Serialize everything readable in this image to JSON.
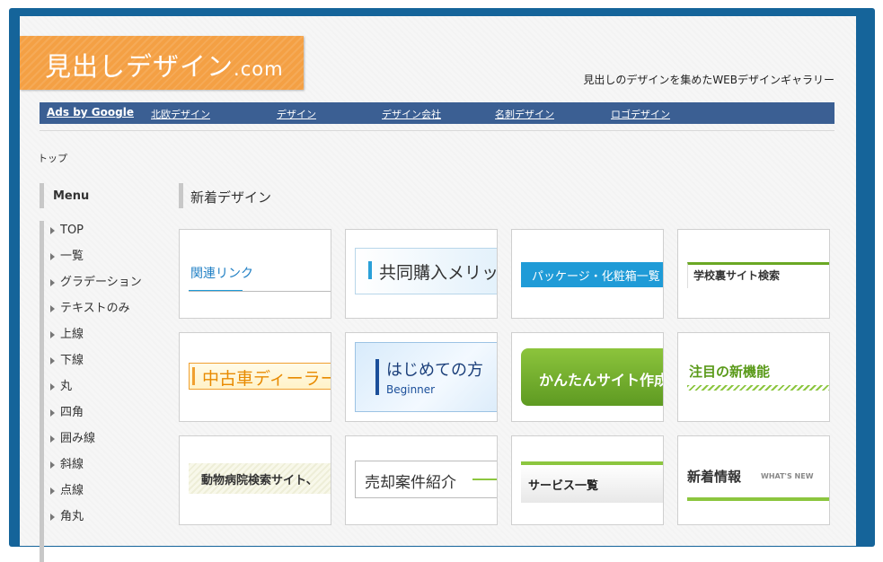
{
  "header": {
    "logo_main": "見出しデザイン",
    "logo_suffix": ".com",
    "tagline": "見出しのデザインを集めたWEBデザインギャラリー"
  },
  "nav": {
    "ads_label": "Ads by Google",
    "links": [
      "北欧デザイン",
      "デザイン",
      "デザイン会社",
      "名刺デザイン",
      "ロゴデザイン"
    ]
  },
  "breadcrumb": "トップ",
  "sidebar": {
    "title": "Menu",
    "items": [
      "TOP",
      "一覧",
      "グラデーション",
      "テキストのみ",
      "上線",
      "下線",
      "丸",
      "四角",
      "囲み線",
      "斜線",
      "点線",
      "角丸"
    ]
  },
  "main": {
    "title": "新着デザイン",
    "cards": [
      {
        "text": "関連リンク"
      },
      {
        "text": "共同購入メリット"
      },
      {
        "text": "パッケージ・化粧箱一覧"
      },
      {
        "text": "学校裏サイト検索"
      },
      {
        "text": "中古車ディーラー"
      },
      {
        "text": "はじめての方",
        "sub": "Beginner"
      },
      {
        "text": "かんたんサイト作成"
      },
      {
        "text": "注目の新機能"
      },
      {
        "text": "動物病院検索サイト、"
      },
      {
        "text": "売却案件紹介"
      },
      {
        "text": "サービス一覧"
      },
      {
        "text": "新着情報",
        "sub": "WHAT'S NEW"
      }
    ]
  },
  "colors": {
    "frame": "#15649a",
    "logo_bg": "#f4a044",
    "nav_bg": "#3b5f93",
    "accent_green": "#8cc63f",
    "accent_blue": "#1f9bd7"
  }
}
